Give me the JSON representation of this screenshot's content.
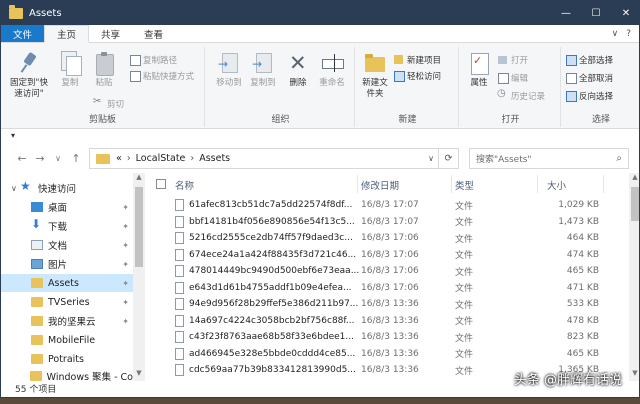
{
  "window": {
    "title": "Assets",
    "controls": {
      "minimize": "—",
      "maximize": "☐",
      "close": "✕"
    }
  },
  "tabs": {
    "file": "文件",
    "home": "主页",
    "share": "共享",
    "view": "查看",
    "collapse": "∨",
    "help": "?"
  },
  "ribbon": {
    "clipboard": {
      "label": "剪贴板",
      "pin": "固定到\"快速访问\"",
      "copy": "复制",
      "paste": "粘贴",
      "copy_path": "复制路径",
      "paste_shortcut": "粘贴快捷方式",
      "cut": "剪切"
    },
    "organize": {
      "label": "组织",
      "move_to": "移动到",
      "copy_to": "复制到",
      "delete": "删除",
      "rename": "重命名"
    },
    "new": {
      "label": "新建",
      "new_folder": "新建文件夹",
      "new_item": "新建项目",
      "easy_access": "轻松访问"
    },
    "open": {
      "label": "打开",
      "properties": "属性",
      "open": "打开",
      "edit": "编辑",
      "history": "历史记录"
    },
    "select": {
      "label": "选择",
      "select_all": "全部选择",
      "select_none": "全部取消",
      "invert": "反向选择"
    }
  },
  "qat": {
    "dropdown": "▾"
  },
  "address": {
    "prefix": "«",
    "crumb1": "LocalState",
    "sep": "›",
    "crumb2": "Assets",
    "search_placeholder": "搜索\"Assets\""
  },
  "nav": {
    "quick_access": "快速访问",
    "items": [
      {
        "label": "桌面",
        "icon": "desktop-icon"
      },
      {
        "label": "下载",
        "icon": "download-icon"
      },
      {
        "label": "文档",
        "icon": "documents-icon"
      },
      {
        "label": "图片",
        "icon": "pictures-icon"
      },
      {
        "label": "Assets",
        "icon": "folder-icon"
      },
      {
        "label": "TVSeries",
        "icon": "folder-icon"
      },
      {
        "label": "我的坚果云",
        "icon": "folder-icon"
      },
      {
        "label": "MobileFile",
        "icon": "folder-icon"
      },
      {
        "label": "Potraits",
        "icon": "folder-icon"
      },
      {
        "label": "Windows 聚集 - Co",
        "icon": "folder-icon"
      }
    ]
  },
  "columns": {
    "name": "名称",
    "date": "修改日期",
    "type": "类型",
    "size": "大小"
  },
  "files": [
    {
      "name": "61afec813cb51dc7a5dd22574f8df...",
      "date": "16/8/3 17:07",
      "type": "文件",
      "size": "1,029 KB"
    },
    {
      "name": "bbf14181b4f056e890856e54f13c5...",
      "date": "16/8/3 17:07",
      "type": "文件",
      "size": "1,473 KB"
    },
    {
      "name": "5216cd2555ce2db74ff57f9daed3c...",
      "date": "16/8/3 17:06",
      "type": "文件",
      "size": "464 KB"
    },
    {
      "name": "674ece24a1a424f88435f3d721c46...",
      "date": "16/8/3 17:06",
      "type": "文件",
      "size": "474 KB"
    },
    {
      "name": "478014449bc9490d500ebf6e73eaa...",
      "date": "16/8/3 17:06",
      "type": "文件",
      "size": "465 KB"
    },
    {
      "name": "e643d1d61b4755addf1b09e4efea...",
      "date": "16/8/3 17:06",
      "type": "文件",
      "size": "471 KB"
    },
    {
      "name": "94e9d956f28b29ffef5e386d211b97...",
      "date": "16/8/3 13:36",
      "type": "文件",
      "size": "533 KB"
    },
    {
      "name": "14a697c4224c3058bcb2bf756c88f...",
      "date": "16/8/3 13:36",
      "type": "文件",
      "size": "478 KB"
    },
    {
      "name": "c43f23f8763aae68b58f33e6bdee1...",
      "date": "16/8/3 13:36",
      "type": "文件",
      "size": "823 KB"
    },
    {
      "name": "ad466945e328e5bbde0cddd4ce85...",
      "date": "16/8/3 13:36",
      "type": "文件",
      "size": "465 KB"
    },
    {
      "name": "cdc569aa77b39b833412813990d5...",
      "date": "16/8/3 13:36",
      "type": "文件",
      "size": "1,365 KB"
    }
  ],
  "status": {
    "count": "55 个项目"
  },
  "watermark": "头条 @胖辉有话说"
}
